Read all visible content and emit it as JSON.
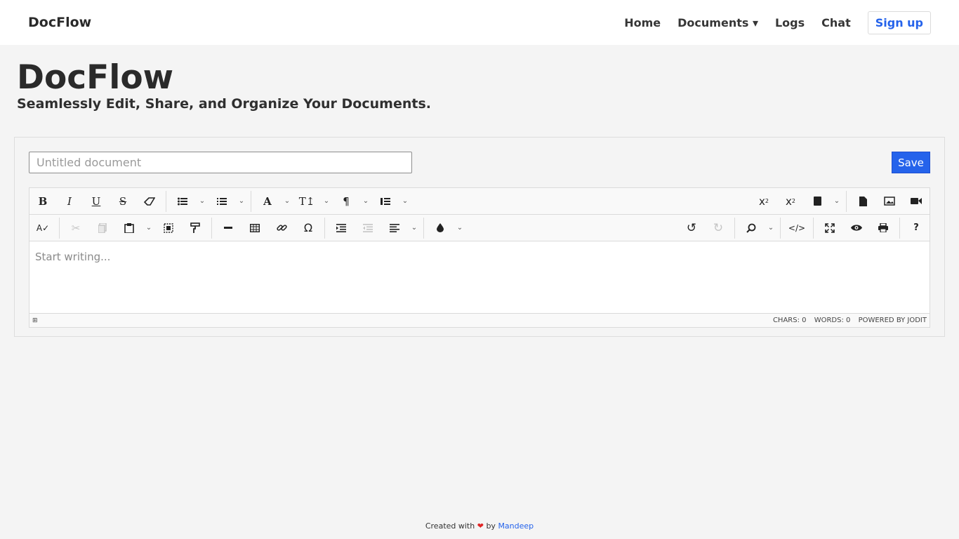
{
  "nav": {
    "brand": "DocFlow",
    "links": [
      "Home",
      "Documents ▾",
      "Logs",
      "Chat"
    ],
    "signup": "Sign up"
  },
  "hero": {
    "title": "DocFlow",
    "subtitle": "Seamlessly Edit, Share, and Organize Your Documents."
  },
  "editor": {
    "title_placeholder": "Untitled document",
    "save_label": "Save",
    "content_placeholder": "Start writing...",
    "status": {
      "chars": "CHARS: 0",
      "words": "WORDS: 0",
      "powered": "POWERED BY JODIT"
    }
  },
  "footer": {
    "prefix": "Created with",
    "heart": "❤",
    "by": "by",
    "author": "Mandeep"
  }
}
